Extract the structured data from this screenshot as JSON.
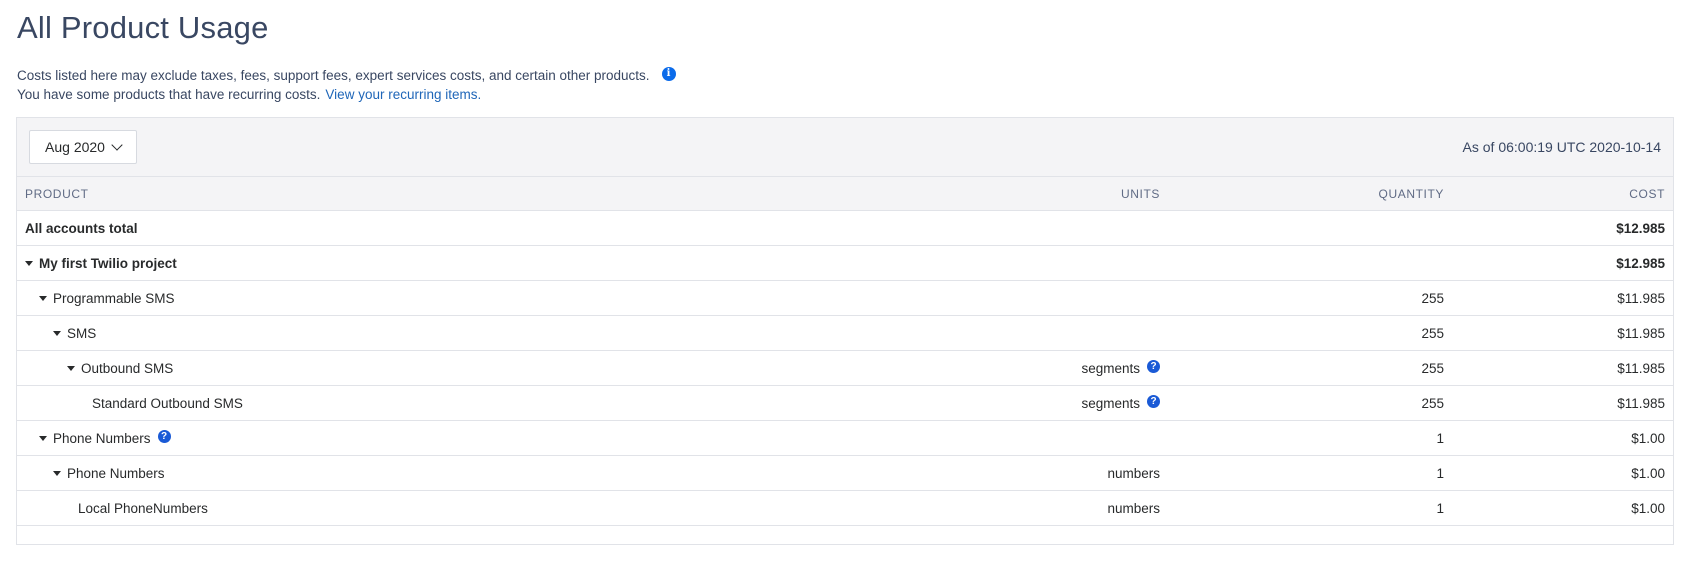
{
  "page": {
    "title": "All Product Usage",
    "intro_line1": "Costs listed here may exclude taxes, fees, support fees, expert services costs, and certain other products.",
    "intro_line2": "You have some products that have recurring costs.",
    "recurring_link": "View your recurring items."
  },
  "toolbar": {
    "month": "Aug 2020",
    "as_of": "As of 06:00:19 UTC 2020-10-14"
  },
  "table": {
    "columns": {
      "product": "PRODUCT",
      "units": "UNITS",
      "quantity": "QUANTITY",
      "cost": "COST"
    },
    "rows": [
      {
        "product": "All accounts total",
        "units": "",
        "quantity": "",
        "cost": "$12.985"
      },
      {
        "product": "My first Twilio project",
        "units": "",
        "quantity": "",
        "cost": "$12.985"
      },
      {
        "product": "Programmable SMS",
        "units": "",
        "quantity": "255",
        "cost": "$11.985"
      },
      {
        "product": "SMS",
        "units": "",
        "quantity": "255",
        "cost": "$11.985"
      },
      {
        "product": "Outbound SMS",
        "units": "segments",
        "quantity": "255",
        "cost": "$11.985"
      },
      {
        "product": "Standard Outbound SMS",
        "units": "segments",
        "quantity": "255",
        "cost": "$11.985"
      },
      {
        "product": "Phone Numbers",
        "units": "",
        "quantity": "1",
        "cost": "$1.00"
      },
      {
        "product": "Phone Numbers",
        "units": "numbers",
        "quantity": "1",
        "cost": "$1.00"
      },
      {
        "product": "Local PhoneNumbers",
        "units": "numbers",
        "quantity": "1",
        "cost": "$1.00"
      }
    ]
  },
  "icons": {
    "info": "info-icon",
    "help": "question-icon",
    "expand": "caret-down-icon",
    "dropdown": "chevron-down-icon"
  },
  "colors": {
    "link": "#1f66b8",
    "info": "#0b6bea",
    "help": "#1a5ad6"
  }
}
